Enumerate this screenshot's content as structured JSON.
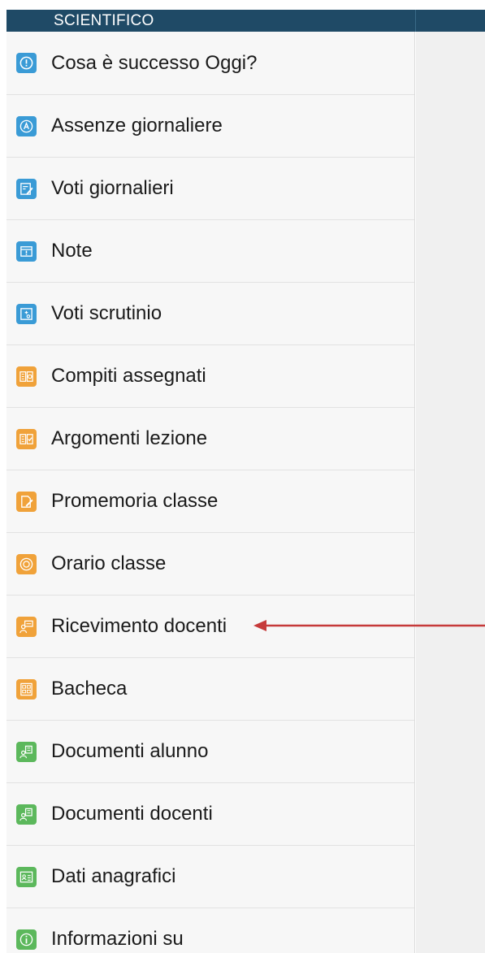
{
  "header": {
    "title": "SCIENTIFICO"
  },
  "colors": {
    "header": "#1f4a66",
    "blue": "#3a9bd6",
    "orange": "#f0a23a",
    "green": "#5cb85c",
    "arrow": "#c63a3a"
  },
  "menu": {
    "items": [
      {
        "label": "Cosa è successo Oggi?",
        "icon": "alert-circle-icon",
        "color": "blue"
      },
      {
        "label": "Assenze giornaliere",
        "icon": "absence-a-icon",
        "color": "blue"
      },
      {
        "label": "Voti giornalieri",
        "icon": "grade-edit-icon",
        "color": "blue"
      },
      {
        "label": "Note",
        "icon": "note-icon",
        "color": "blue"
      },
      {
        "label": "Voti scrutinio",
        "icon": "report-card-icon",
        "color": "blue"
      },
      {
        "label": "Compiti assegnati",
        "icon": "homework-book-icon",
        "color": "orange"
      },
      {
        "label": "Argomenti lezione",
        "icon": "lesson-book-icon",
        "color": "orange"
      },
      {
        "label": "Promemoria classe",
        "icon": "reminder-icon",
        "color": "orange"
      },
      {
        "label": "Orario classe",
        "icon": "clock-icon",
        "color": "orange"
      },
      {
        "label": "Ricevimento docenti",
        "icon": "teacher-meeting-icon",
        "color": "orange"
      },
      {
        "label": "Bacheca",
        "icon": "bulletin-board-icon",
        "color": "orange"
      },
      {
        "label": "Documenti alunno",
        "icon": "student-documents-icon",
        "color": "green"
      },
      {
        "label": "Documenti docenti",
        "icon": "teacher-documents-icon",
        "color": "green"
      },
      {
        "label": "Dati anagrafici",
        "icon": "id-card-icon",
        "color": "green"
      },
      {
        "label": "Informazioni su",
        "icon": "info-icon",
        "color": "green"
      }
    ]
  },
  "annotation": {
    "arrow_target": "Ricevimento docenti"
  }
}
